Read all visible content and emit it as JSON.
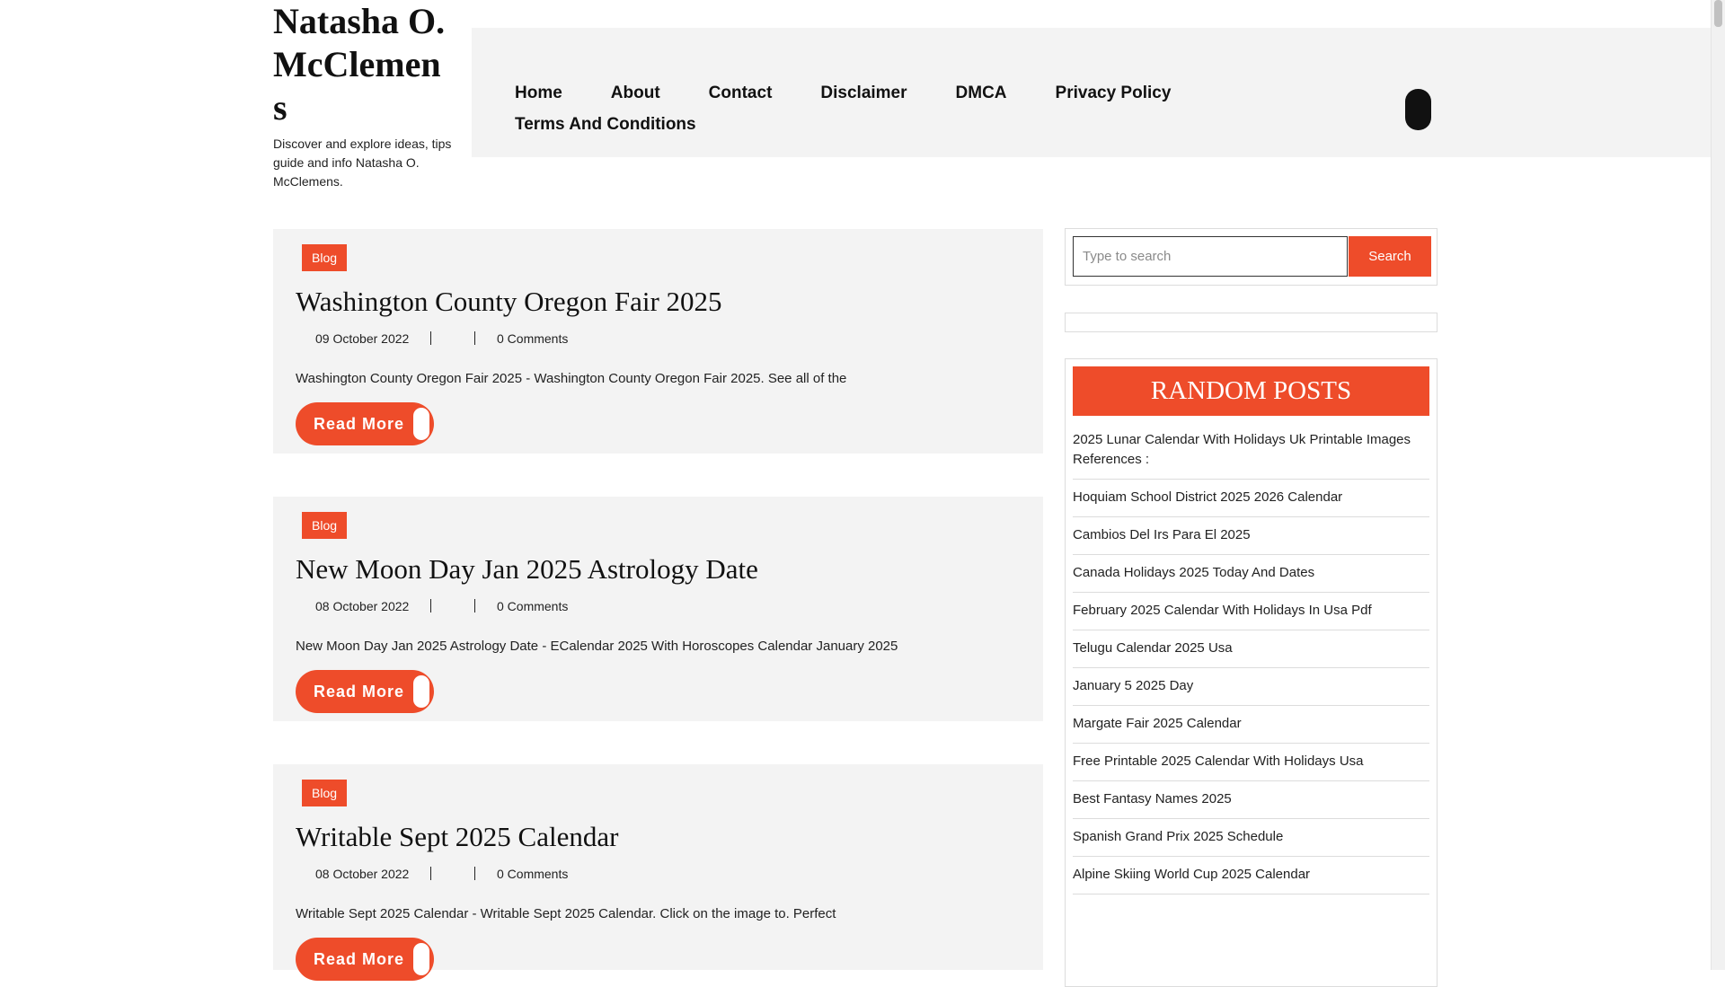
{
  "site": {
    "title": "Natasha O. McClemens",
    "tagline": "Discover and explore ideas, tips guide and info Natasha O. McClemens."
  },
  "nav": {
    "items": [
      {
        "label": "Home"
      },
      {
        "label": "About"
      },
      {
        "label": "Contact"
      },
      {
        "label": "Disclaimer"
      },
      {
        "label": "DMCA"
      },
      {
        "label": "Privacy Policy"
      },
      {
        "label": "Terms And Conditions"
      }
    ],
    "menu_icon": "menu-toggle-icon"
  },
  "posts": [
    {
      "category": "Blog",
      "title": "Washington County Oregon Fair 2025",
      "date": "09 October 2022",
      "comments": "0 Comments",
      "excerpt": "Washington County Oregon Fair 2025 - Washington County Oregon Fair 2025. See all of the",
      "read_more": "Read More"
    },
    {
      "category": "Blog",
      "title": "New Moon Day Jan 2025 Astrology Date",
      "date": "08 October 2022",
      "comments": "0 Comments",
      "excerpt": "New Moon Day Jan 2025 Astrology Date - ECalendar 2025 With Horoscopes Calendar January 2025",
      "read_more": "Read More"
    },
    {
      "category": "Blog",
      "title": "Writable Sept 2025 Calendar",
      "date": "08 October 2022",
      "comments": "0 Comments",
      "excerpt": "Writable Sept 2025 Calendar - Writable Sept 2025 Calendar. Click on the image to. Perfect",
      "read_more": "Read More"
    }
  ],
  "sidebar": {
    "search": {
      "placeholder": "Type to search",
      "value": "",
      "button": "Search"
    },
    "random_posts": {
      "heading": "RANDOM POSTS",
      "items": [
        "2025 Lunar Calendar With Holidays Uk Printable Images References :",
        "Hoquiam School District 2025 2026 Calendar",
        "Cambios Del Irs Para El 2025",
        "Canada Holidays 2025 Today And Dates",
        "February 2025 Calendar With Holidays In Usa Pdf",
        "Telugu Calendar 2025 Usa",
        "January 5 2025 Day",
        "Margate Fair 2025 Calendar",
        "Free Printable 2025 Calendar With Holidays Usa",
        "Best Fantasy Names 2025",
        "Spanish Grand Prix 2025 Schedule",
        "Alpine Skiing World Cup 2025 Calendar"
      ]
    }
  },
  "colors": {
    "accent": "#ee4c2a",
    "panel": "#f3f3f3",
    "text": "#222222"
  }
}
